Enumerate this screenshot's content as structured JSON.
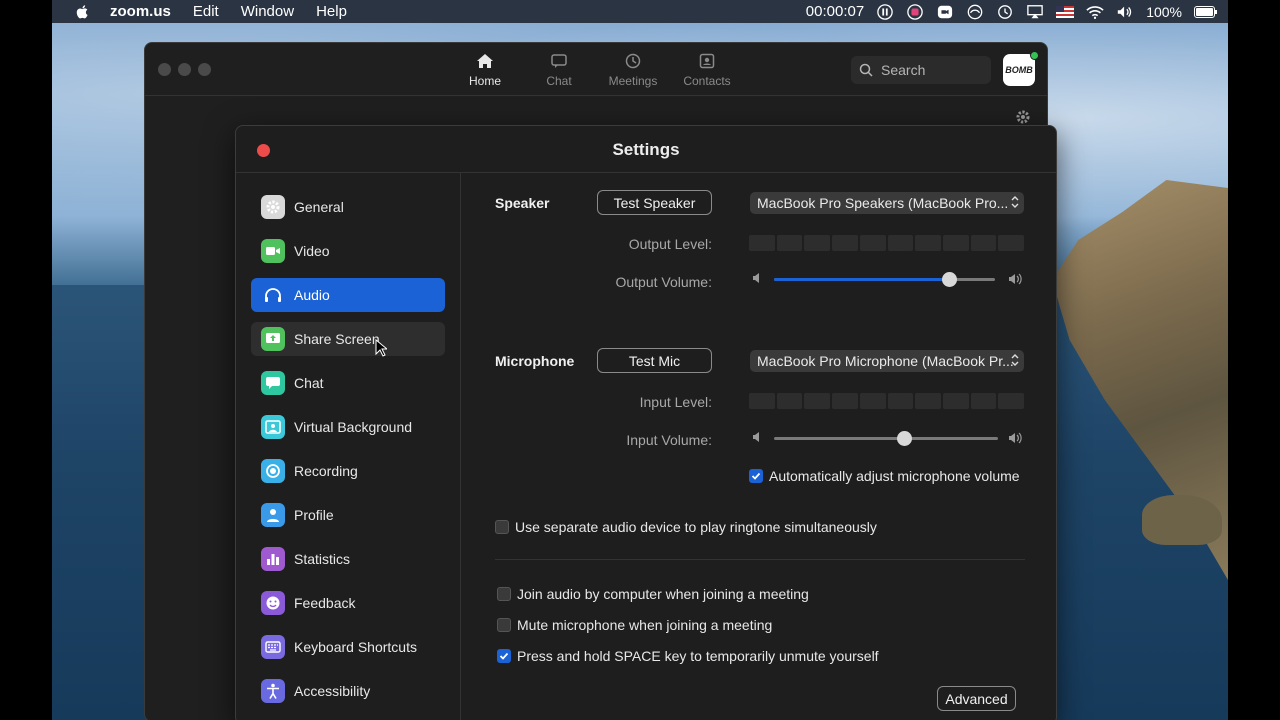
{
  "menubar": {
    "app_name": "zoom.us",
    "items": [
      "Edit",
      "Window",
      "Help"
    ],
    "timer": "00:00:07",
    "battery": "100%"
  },
  "zoom_window": {
    "tabs": [
      {
        "label": "Home",
        "icon": "home-icon",
        "active": true
      },
      {
        "label": "Chat",
        "icon": "chat-icon",
        "active": false
      },
      {
        "label": "Meetings",
        "icon": "clock-icon",
        "active": false
      },
      {
        "label": "Contacts",
        "icon": "contacts-icon",
        "active": false
      }
    ],
    "search_placeholder": "Search",
    "avatar_text": "BOMB"
  },
  "settings": {
    "title": "Settings",
    "sidebar": [
      {
        "label": "General",
        "icon": "gear-icon",
        "color": "#d9d9d9"
      },
      {
        "label": "Video",
        "icon": "video-icon",
        "color": "#4fc25d"
      },
      {
        "label": "Audio",
        "icon": "headphones-icon",
        "color": "#1a62d6",
        "active": true
      },
      {
        "label": "Share Screen",
        "icon": "share-screen-icon",
        "color": "#4fc25d",
        "hover": true
      },
      {
        "label": "Chat",
        "icon": "chat-bubble-icon",
        "color": "#2fc7a0"
      },
      {
        "label": "Virtual Background",
        "icon": "virtual-background-icon",
        "color": "#3bc8d8"
      },
      {
        "label": "Recording",
        "icon": "record-icon",
        "color": "#3ab0e8"
      },
      {
        "label": "Profile",
        "icon": "profile-icon",
        "color": "#3a9ae8"
      },
      {
        "label": "Statistics",
        "icon": "statistics-icon",
        "color": "#a05ad0"
      },
      {
        "label": "Feedback",
        "icon": "feedback-icon",
        "color": "#8a5ad8"
      },
      {
        "label": "Keyboard Shortcuts",
        "icon": "keyboard-icon",
        "color": "#7a6ae0"
      },
      {
        "label": "Accessibility",
        "icon": "accessibility-icon",
        "color": "#6a6ae0"
      }
    ],
    "audio": {
      "speaker_label": "Speaker",
      "test_speaker": "Test Speaker",
      "speaker_device": "MacBook Pro Speakers (MacBook Pro...",
      "output_level_label": "Output Level:",
      "output_volume_label": "Output Volume:",
      "output_volume": 0.79,
      "microphone_label": "Microphone",
      "test_mic": "Test Mic",
      "mic_device": "MacBook Pro Microphone (MacBook Pr...",
      "input_level_label": "Input Level:",
      "input_volume_label": "Input Volume:",
      "input_volume": 0.58,
      "auto_adjust": {
        "label": "Automatically adjust microphone volume",
        "checked": true
      },
      "separate_ringtone": {
        "label": "Use separate audio device to play ringtone simultaneously",
        "checked": false
      },
      "join_audio": {
        "label": "Join audio by computer when joining a meeting",
        "checked": false
      },
      "mute_mic": {
        "label": "Mute microphone when joining a meeting",
        "checked": false
      },
      "space_unmute": {
        "label": "Press and hold SPACE key to temporarily unmute yourself",
        "checked": true
      },
      "advanced": "Advanced"
    }
  }
}
